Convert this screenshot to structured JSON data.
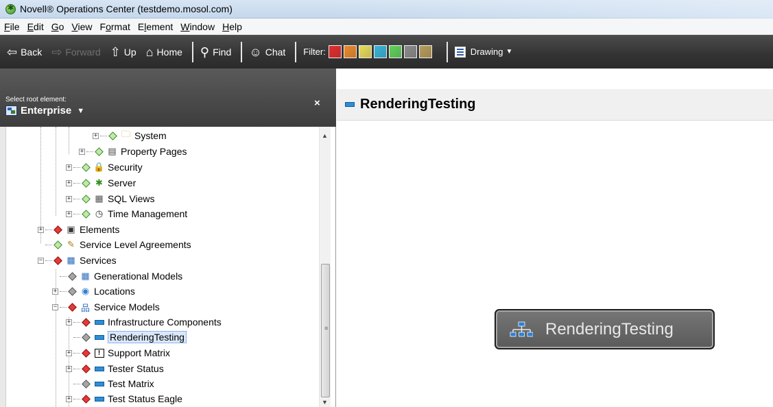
{
  "window": {
    "title": "Novell® Operations Center (testdemo.mosol.com)"
  },
  "menubar": [
    {
      "label": "File",
      "accel": "F",
      "rest": "ile"
    },
    {
      "label": "Edit",
      "accel": "E",
      "rest": "dit"
    },
    {
      "label": "Go",
      "accel": "G",
      "rest": "o"
    },
    {
      "label": "View",
      "accel": "V",
      "rest": "iew"
    },
    {
      "label": "Format",
      "prefix": "F",
      "accel": "o",
      "rest": "rmat"
    },
    {
      "label": "Element",
      "prefix": "E",
      "accel": "l",
      "rest": "ement"
    },
    {
      "label": "Window",
      "accel": "W",
      "rest": "indow"
    },
    {
      "label": "Help",
      "accel": "H",
      "rest": "elp"
    }
  ],
  "toolbar": {
    "back": "Back",
    "forward": "Forward",
    "up": "Up",
    "home": "Home",
    "find": "Find",
    "chat": "Chat",
    "filter": "Filter:",
    "filter_colors": [
      "#e02b2b",
      "#e8892a",
      "#e6da5a",
      "#38b3d6",
      "#5fd05a",
      "#8a8a8a",
      "#b79a5a"
    ],
    "drawing": "Drawing"
  },
  "left_panel": {
    "select_label": "Select root element:",
    "root_value": "Enterprise",
    "close": "×",
    "tree": [
      {
        "label": "System",
        "icon": "folder-icon"
      },
      {
        "label": "Property Pages",
        "icon": "property-pages-icon"
      },
      {
        "label": "Security",
        "icon": "security-icon"
      },
      {
        "label": "Server",
        "icon": "server-icon"
      },
      {
        "label": "SQL Views",
        "icon": "sql-views-icon"
      },
      {
        "label": "Time Management",
        "icon": "time-management-icon"
      },
      {
        "label": "Elements",
        "icon": "elements-icon"
      },
      {
        "label": "Service Level Agreements",
        "icon": "sla-icon"
      },
      {
        "label": "Services",
        "icon": "services-icon"
      },
      {
        "label": "Generational Models",
        "icon": "generational-models-icon"
      },
      {
        "label": "Locations",
        "icon": "globe-icon"
      },
      {
        "label": "Service Models",
        "icon": "hierarchy-icon"
      },
      {
        "label": "Infrastructure Components",
        "icon": "element-icon"
      },
      {
        "label": "RenderingTesting",
        "icon": "element-icon"
      },
      {
        "label": "Support Matrix",
        "icon": "matrix-icon"
      },
      {
        "label": "Tester Status",
        "icon": "element-icon"
      },
      {
        "label": "Test Matrix",
        "icon": "element-icon"
      },
      {
        "label": "Test Status Eagle",
        "icon": "element-icon"
      }
    ]
  },
  "right_panel": {
    "title": "RenderingTesting",
    "node_label": "RenderingTesting"
  }
}
